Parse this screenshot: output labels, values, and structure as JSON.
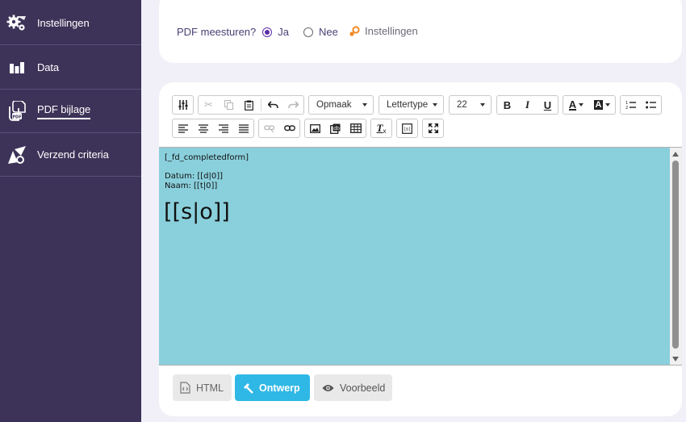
{
  "sidebar": {
    "items": [
      {
        "label": "Instellingen",
        "icon": "gears-icon"
      },
      {
        "label": "Data",
        "icon": "bar-chart-icon"
      },
      {
        "label": "PDF bijlage",
        "icon": "pdf-attachment-icon",
        "active": true
      },
      {
        "label": "Verzend criteria",
        "icon": "send-criteria-icon"
      }
    ]
  },
  "pdf_option": {
    "question": "PDF meesturen?",
    "yes_label": "Ja",
    "no_label": "Nee",
    "selected": "Ja",
    "settings_label": "Instellingen"
  },
  "toolbar": {
    "format_select": "Opmaak",
    "font_select": "Lettertype",
    "size_select": "22"
  },
  "editor": {
    "line1": "[_fd_completedform]",
    "line2": "Datum: [[d|0]]",
    "line3": "Naam: [[t|0]]",
    "line4": "[[s|o]]"
  },
  "modes": {
    "html": "HTML",
    "design": "Ontwerp",
    "preview": "Voorbeeld",
    "active": "Ontwerp"
  },
  "colors": {
    "sidebar_bg": "#3d3358",
    "editor_bg": "#8ad0dc",
    "active_mode": "#2fb8e6",
    "accent": "#5b2ea6"
  }
}
